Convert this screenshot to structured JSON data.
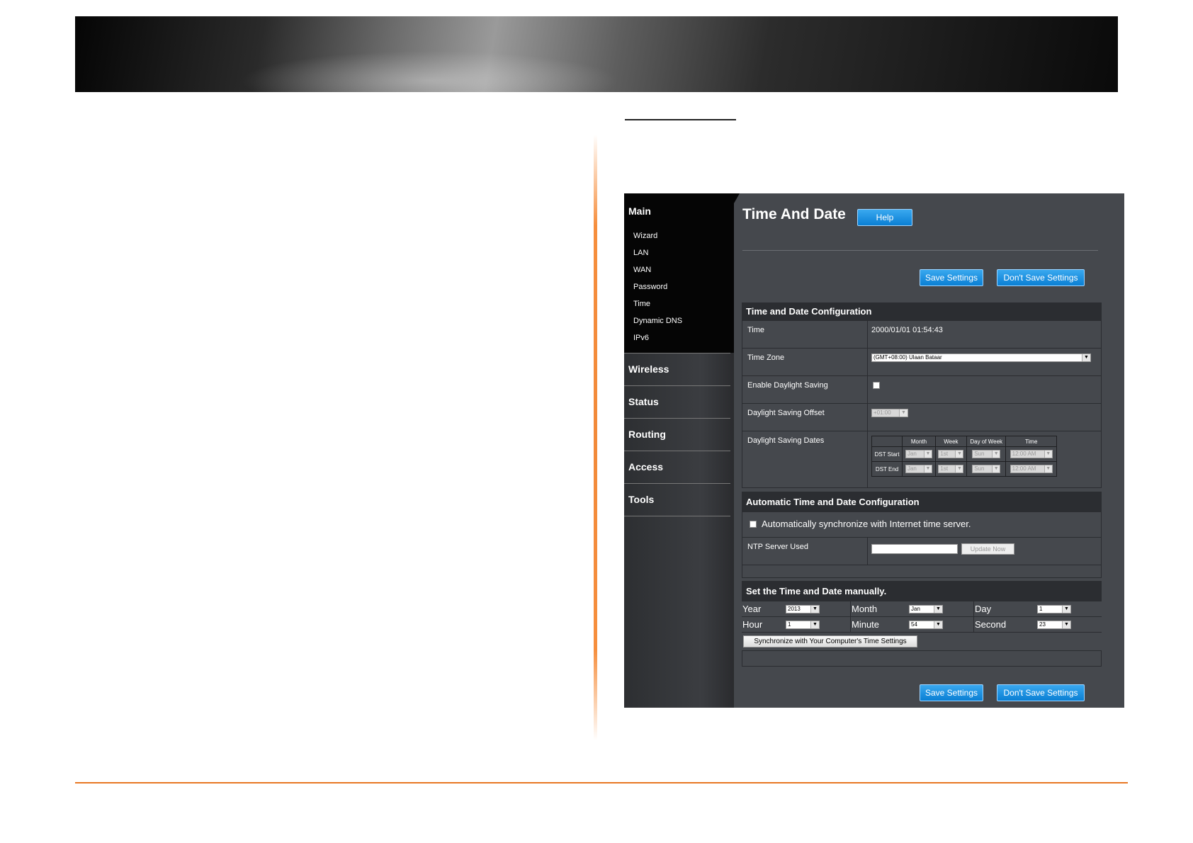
{
  "sidebar": {
    "main_title": "Main",
    "main_items": [
      "Wizard",
      "LAN",
      "WAN",
      "Password",
      "Time",
      "Dynamic DNS",
      "IPv6"
    ],
    "sections": [
      "Wireless",
      "Status",
      "Routing",
      "Access",
      "Tools"
    ]
  },
  "page": {
    "title": "Time And Date",
    "help_label": "Help",
    "save_label": "Save Settings",
    "dont_save_label": "Don't Save Settings"
  },
  "time_date_config": {
    "header": "Time and Date Configuration",
    "time_label": "Time",
    "time_value": "2000/01/01 01:54:43",
    "timezone_label": "Time Zone",
    "timezone_value": "(GMT+08:00) Ulaan Bataar",
    "dst_enable_label": "Enable Daylight Saving",
    "dst_offset_label": "Daylight Saving Offset",
    "dst_offset_value": "+01:00",
    "dst_dates_label": "Daylight Saving Dates",
    "dst_table": {
      "headers": [
        "Month",
        "Week",
        "Day of Week",
        "Time"
      ],
      "start_label": "DST Start",
      "end_label": "DST End",
      "start": {
        "month": "Jan",
        "week": "1st",
        "day": "Sun",
        "time": "12:00 AM"
      },
      "end": {
        "month": "Jan",
        "week": "1st",
        "day": "Sun",
        "time": "12:00 AM"
      }
    }
  },
  "auto_config": {
    "header": "Automatic Time and Date Configuration",
    "sync_label": "Automatically synchronize with Internet time server.",
    "ntp_label": "NTP Server Used",
    "ntp_value": "",
    "update_label": "Update Now"
  },
  "manual": {
    "header": "Set the Time and Date manually.",
    "year_label": "Year",
    "year_value": "2013",
    "month_label": "Month",
    "month_value": "Jan",
    "day_label": "Day",
    "day_value": "1",
    "hour_label": "Hour",
    "hour_value": "1",
    "minute_label": "Minute",
    "minute_value": "54",
    "second_label": "Second",
    "second_value": "23",
    "sync_button": "Synchronize with Your Computer's Time Settings"
  },
  "colors": {
    "accent": "#e87722",
    "button": "#0a7fd4",
    "panel": "#45484d"
  }
}
